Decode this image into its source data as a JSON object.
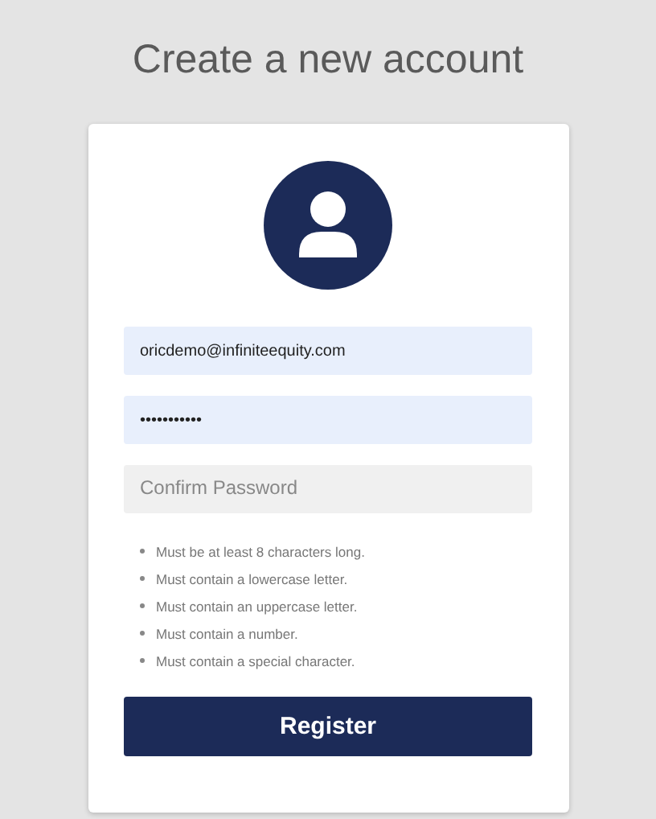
{
  "title": "Create a new account",
  "fields": [
    {
      "value": "oricdemo@infiniteequity.com",
      "filled": true
    },
    {
      "value": "•••••••••••",
      "filled": true
    },
    {
      "placeholder": "Confirm Password",
      "filled": false
    }
  ],
  "requirements": [
    "Must be at least 8 characters long.",
    "Must contain a lowercase letter.",
    "Must contain an uppercase letter.",
    "Must contain a number.",
    "Must contain a special character."
  ],
  "submit_button": "Register"
}
